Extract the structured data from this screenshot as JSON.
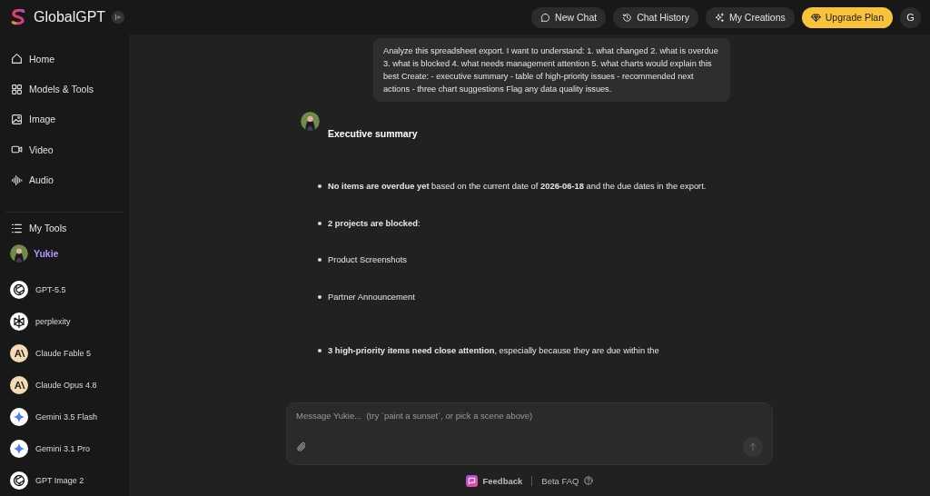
{
  "app": {
    "name": "GlobalGPT"
  },
  "nav": [
    {
      "label": "Home"
    },
    {
      "label": "Models & Tools"
    },
    {
      "label": "Image"
    },
    {
      "label": "Video"
    },
    {
      "label": "Audio"
    }
  ],
  "my_tools": {
    "label": "My Tools"
  },
  "active_bot": {
    "name": "Yukie"
  },
  "models": [
    {
      "name": "GPT-5.5",
      "kind": "knot"
    },
    {
      "name": "perplexity",
      "kind": "burst"
    },
    {
      "name": "Claude Fable 5",
      "kind": "peaks"
    },
    {
      "name": "Claude Opus 4.8",
      "kind": "peaks"
    },
    {
      "name": "Gemini 3.5 Flash",
      "kind": "star"
    },
    {
      "name": "Gemini 3.1 Pro",
      "kind": "star"
    },
    {
      "name": "GPT Image 2",
      "kind": "knot"
    }
  ],
  "top_buttons": [
    {
      "label": "New Chat",
      "kind": "plain"
    },
    {
      "label": "Chat History",
      "kind": "plain"
    },
    {
      "label": "My Creations",
      "kind": "plain"
    },
    {
      "label": "Upgrade Plan",
      "kind": "primary"
    }
  ],
  "account": {
    "initial": "G"
  },
  "user_message": "Analyze this spreadsheet export. I want to understand: 1. what changed 2. what is overdue 3. what is blocked 4. what needs management attention 5. what charts would explain this best Create: - executive summary - table of high-priority issues - recommended next actions - three chart suggestions Flag any data quality issues.",
  "reply": {
    "heading": "Executive summary",
    "bullets": [
      "**No items are overdue yet** based on the current date of **2026-06-18** and the due dates in the export.",
      "**2 projects are blocked**:",
      "Product Screenshots",
      "Partner Announcement",
      "**3 high-priority items need close attention**, especially because they are due within the"
    ]
  },
  "composer": {
    "placeholder": "Message Yukie...  (try `paint a sunset`, or pick a scene above)"
  },
  "footer": {
    "feedback": "Feedback",
    "faq": "Beta FAQ"
  }
}
